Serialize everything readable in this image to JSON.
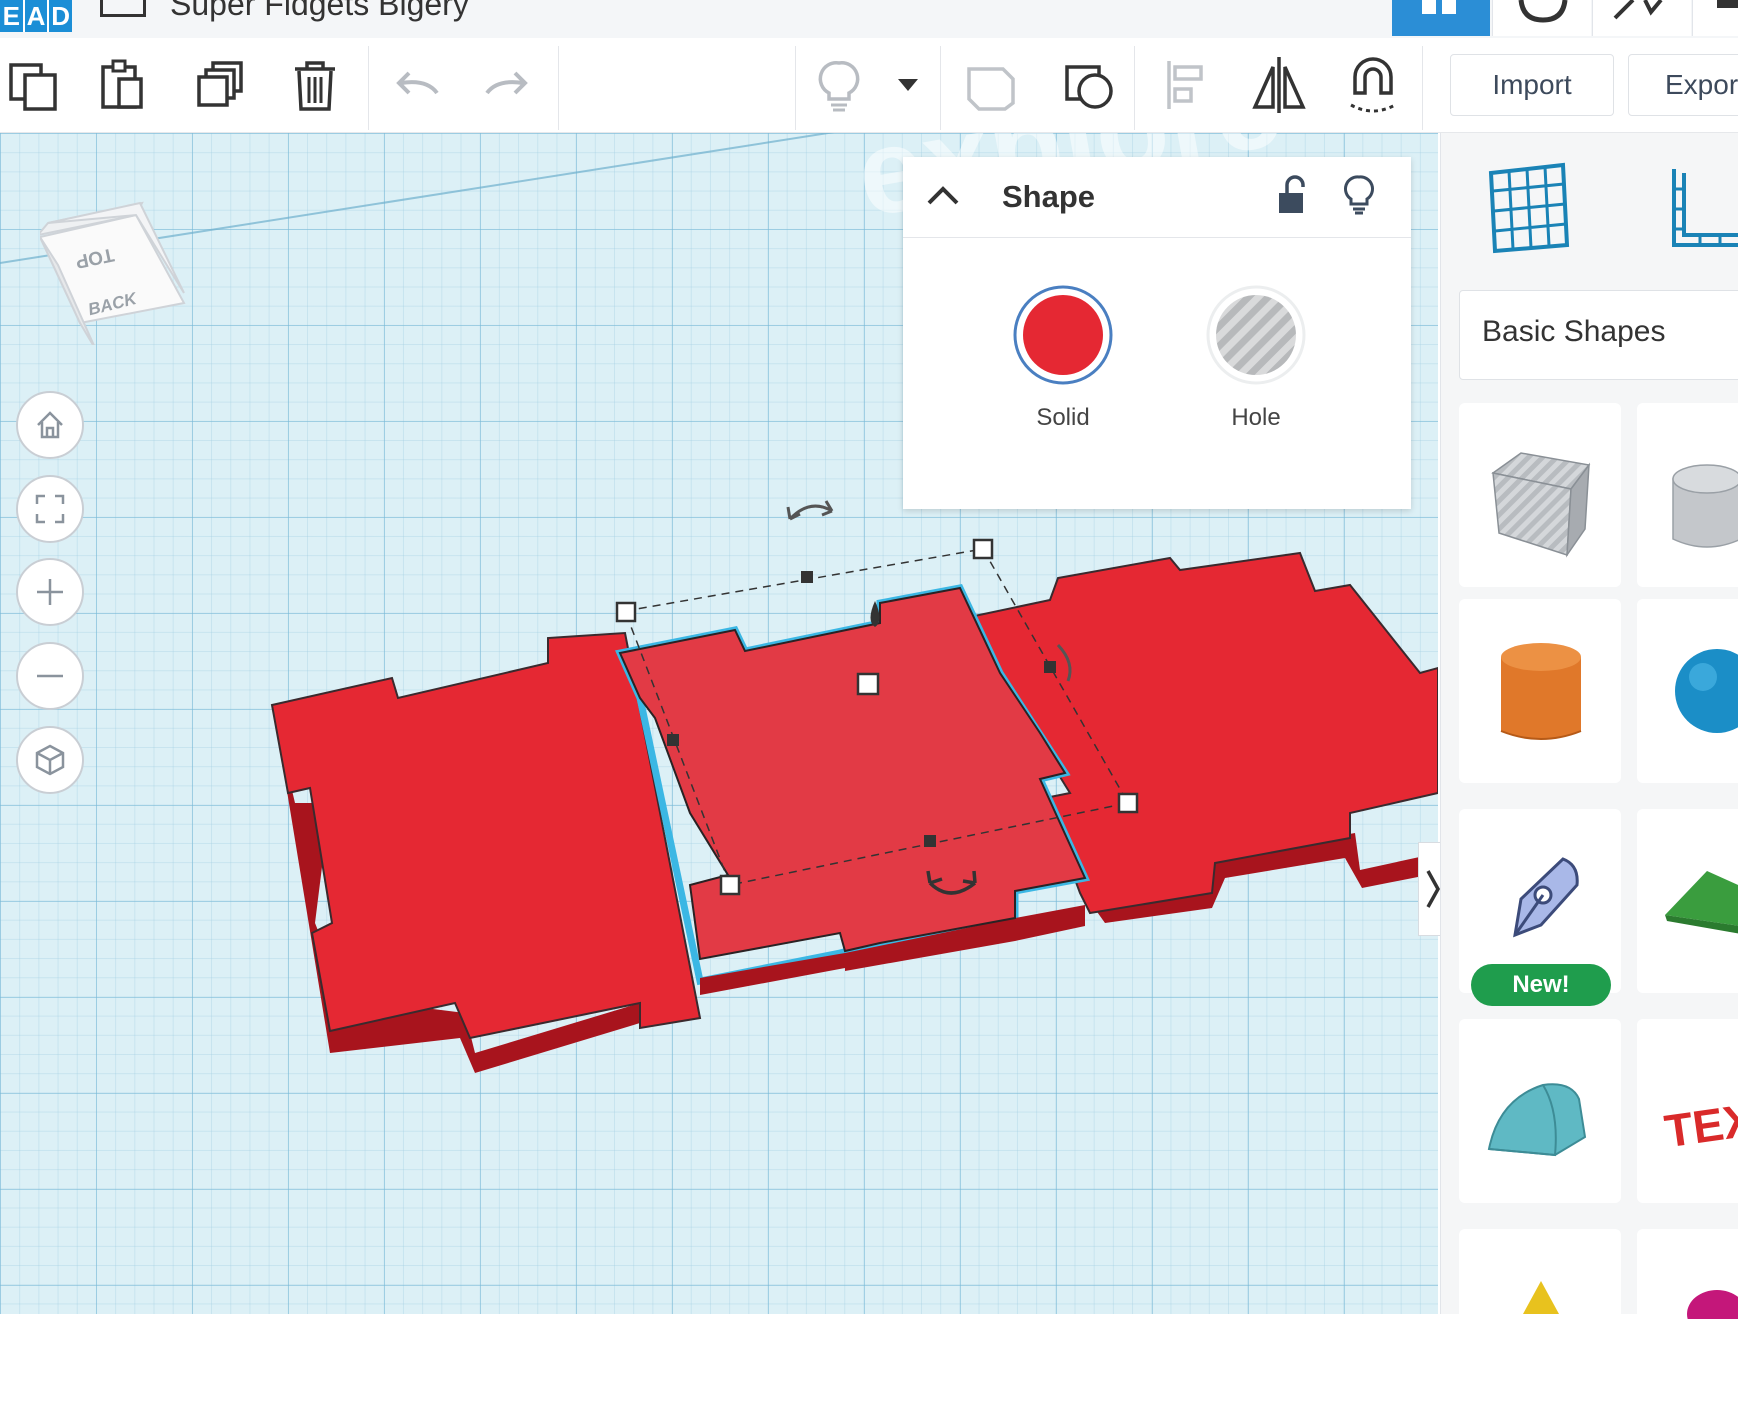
{
  "header": {
    "logo_letters": [
      "E",
      "A",
      "D"
    ],
    "project_title": "Super Fidgets Bigery"
  },
  "toolbar": {
    "import_label": "Import",
    "export_label": "Expor"
  },
  "viewcube": {
    "top_label": "TOP",
    "back_label": "BACK"
  },
  "inspector": {
    "title": "Shape",
    "solid_label": "Solid",
    "hole_label": "Hole",
    "solid_color": "#e52833",
    "hole_color": "#b7b9bb"
  },
  "shapes_panel": {
    "category": "Basic Shapes",
    "new_badge": "New!",
    "shape_colors": {
      "box": "#b8bcc0",
      "cylinder": "#e0782a",
      "sphere": "#1b8ec7",
      "roof": "#3a9d3e",
      "half_cylinder": "#5fb9c4",
      "text": "#d92a2a"
    }
  },
  "workplane": {
    "watermark": "explore",
    "object_color": "#e52833",
    "selection_color": "#3bb7e4"
  }
}
